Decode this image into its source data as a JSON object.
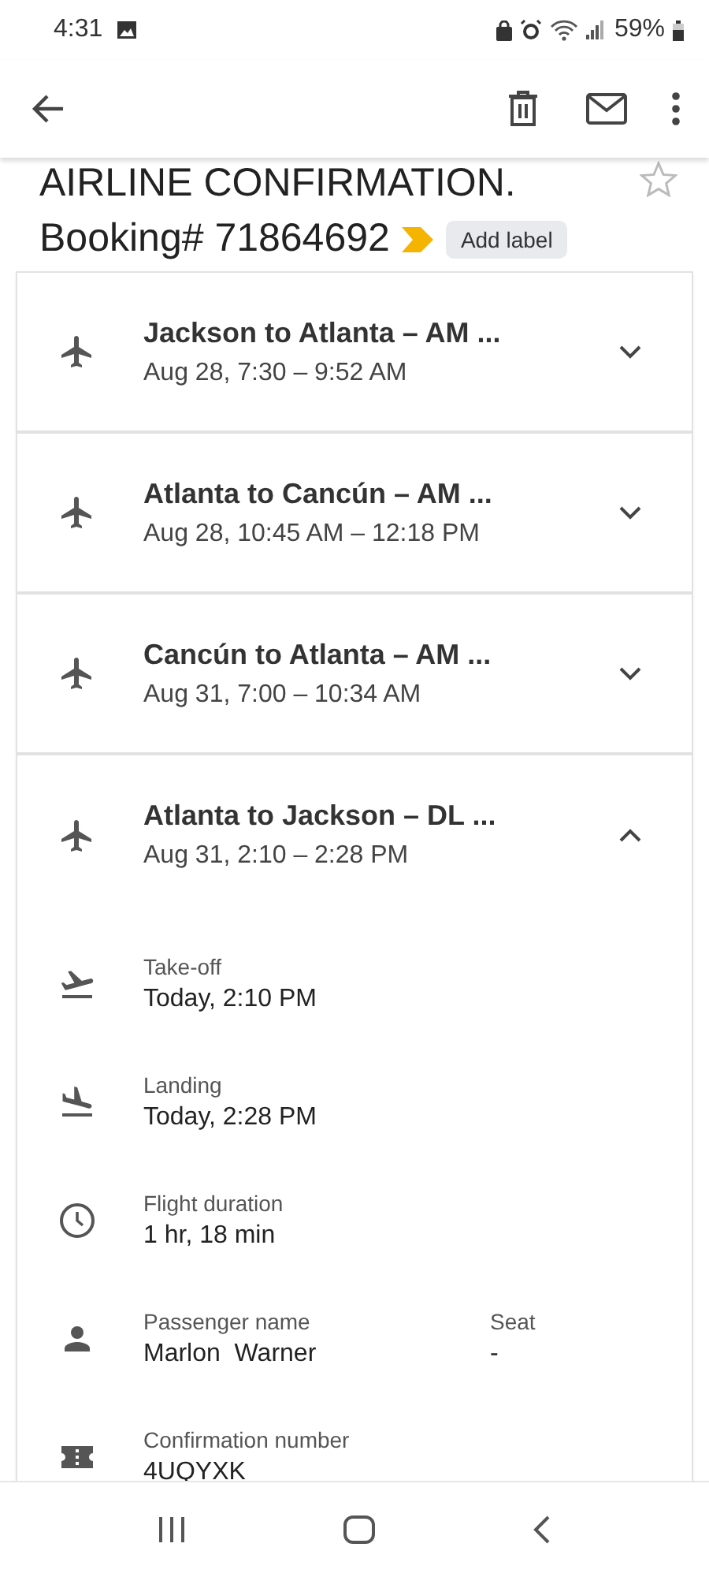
{
  "status_bar": {
    "time": "4:31",
    "battery": "59%"
  },
  "subject": {
    "title": "AIRLINE CONFIRMATION.",
    "booking": "Booking# 71864692",
    "starred": false,
    "label_button": "Add label"
  },
  "flights": [
    {
      "route": "Jackson to Atlanta – AM ...",
      "times": "Aug 28, 7:30 – 9:52 AM",
      "expanded": false
    },
    {
      "route": "Atlanta to Cancún – AM ...",
      "times": "Aug 28, 10:45 AM – 12:18 PM",
      "expanded": false
    },
    {
      "route": "Cancún to Atlanta – AM ...",
      "times": "Aug 31, 7:00 – 10:34 AM",
      "expanded": false
    },
    {
      "route": "Atlanta to Jackson – DL ...",
      "times": "Aug 31, 2:10 – 2:28 PM",
      "expanded": true,
      "details": [
        {
          "kind": "takeoff",
          "label": "Take-off",
          "value": "Today, 2:10 PM"
        },
        {
          "kind": "landing",
          "label": "Landing",
          "value": "Today, 2:28 PM"
        },
        {
          "kind": "clock",
          "label": "Flight duration",
          "value": "1 hr, 18 min"
        },
        {
          "kind": "person",
          "label": "Passenger name",
          "value": "Marlon  Warner",
          "extra_label": "Seat",
          "extra_value": "-"
        },
        {
          "kind": "ticket",
          "label": "Confirmation number",
          "value": "4UQYXK"
        }
      ]
    }
  ]
}
